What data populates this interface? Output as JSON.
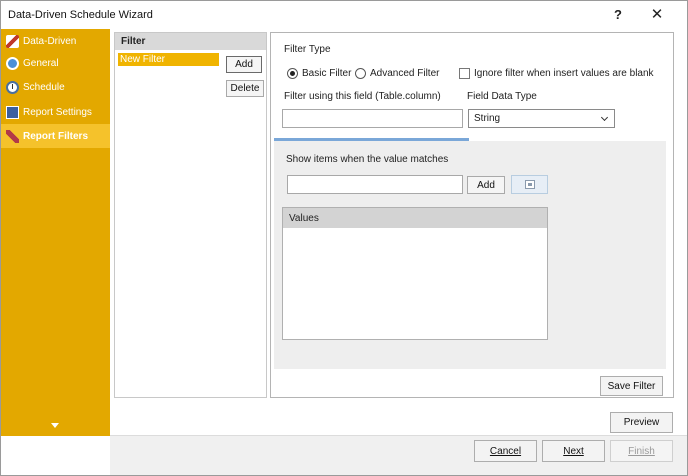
{
  "window": {
    "title": "Data-Driven Schedule Wizard",
    "help_glyph": "?",
    "close_glyph": "✕"
  },
  "sidebar": {
    "items": [
      {
        "label": "Data-Driven",
        "icon": "data-driven-icon"
      },
      {
        "label": "General",
        "icon": "general-icon"
      },
      {
        "label": "Schedule",
        "icon": "schedule-clock-icon"
      },
      {
        "label": "Report Settings",
        "icon": "report-settings-icon"
      },
      {
        "label": "Report Filters",
        "icon": "report-filters-icon"
      }
    ],
    "active_index": 4,
    "accent_color": "#e3a800",
    "active_color": "#f5c22b"
  },
  "filter_list": {
    "header": "Filter",
    "items": [
      "New Filter"
    ],
    "add_label": "Add",
    "delete_label": "Delete"
  },
  "filter_detail": {
    "filter_type_label": "Filter Type",
    "basic_filter_label": "Basic Filter",
    "advanced_filter_label": "Advanced Filter",
    "selected_type": "Basic Filter",
    "ignore_blank_label": "Ignore filter when insert values are blank",
    "ignore_blank_checked": false,
    "field_label": "Filter using this field (Table.column)",
    "field_value": "",
    "data_type_label": "Field Data Type",
    "data_type_value": "String",
    "match_label": "Show items when the value matches",
    "match_value": "",
    "match_add_label": "Add",
    "values_header": "Values",
    "values": [],
    "save_filter_label": "Save Filter"
  },
  "footer": {
    "preview_label": "Preview",
    "cancel_label": "Cancel",
    "next_label": "Next",
    "finish_label": "Finish"
  }
}
